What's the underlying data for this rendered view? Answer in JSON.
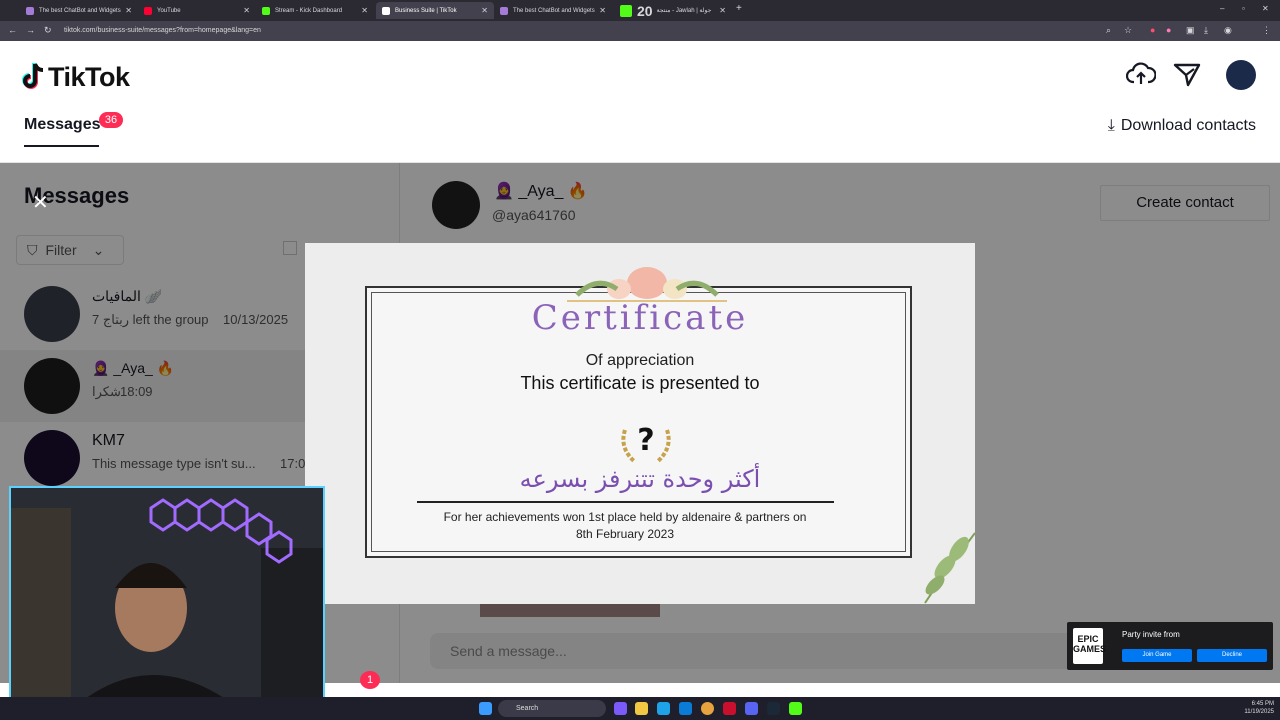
{
  "browser": {
    "tabs": [
      {
        "label": "The best ChatBot and Widgets",
        "fav": "#a57bd8"
      },
      {
        "label": "YouTube",
        "fav": "#ff0033"
      },
      {
        "label": "Stream - Kick Dashboard",
        "fav": "#53fc18"
      },
      {
        "label": "Business Suite | TikTok",
        "fav": "#ffffff"
      },
      {
        "label": "The best ChatBot and Widgets",
        "fav": "#a57bd8"
      },
      {
        "label": "20",
        "fav": "#53fc18"
      },
      {
        "label": "منتجة - Jawlah | جولة",
        "fav": "#53fc18"
      }
    ],
    "url": "tiktok.com/business-suite/messages?from=homepage&lang=en"
  },
  "header": {
    "logo_text": "TikTok",
    "tab_messages": "Messages",
    "messages_badge": "36",
    "download_contacts": "Download contacts"
  },
  "left_panel": {
    "title": "Messages",
    "filter_label": "Filter",
    "conversations": [
      {
        "name": "المافيات 🪽",
        "preview": "7 ربتاج left the group",
        "time": "10/13/2025"
      },
      {
        "name": "🧕 _Aya_ 🔥",
        "preview": "شكرا",
        "time": "18:09"
      },
      {
        "name": "KM7",
        "preview": "This message type isn't su...",
        "time": "17:0"
      }
    ]
  },
  "chat": {
    "name": "🧕 _Aya_ 🔥",
    "handle": "@aya641760",
    "create_contact": "Create contact",
    "input_placeholder": "Send a message...",
    "unread_count": "1"
  },
  "certificate": {
    "title": "Certificate",
    "subtitle": "Of appreciation",
    "presented": "This certificate is presented to",
    "name": "أكثر وحدة تتنرفز بسرعه",
    "desc_line1": "For her achievements won 1st place held by aldenaire & partners on",
    "desc_line2": "8th February 2023"
  },
  "epic_popup": {
    "logo": "EPIC GAMES",
    "title": "Party invite from",
    "join": "Join Game",
    "decline": "Decline"
  },
  "taskbar": {
    "search": "Search",
    "time": "6:45 PM",
    "date": "11/19/2025"
  }
}
